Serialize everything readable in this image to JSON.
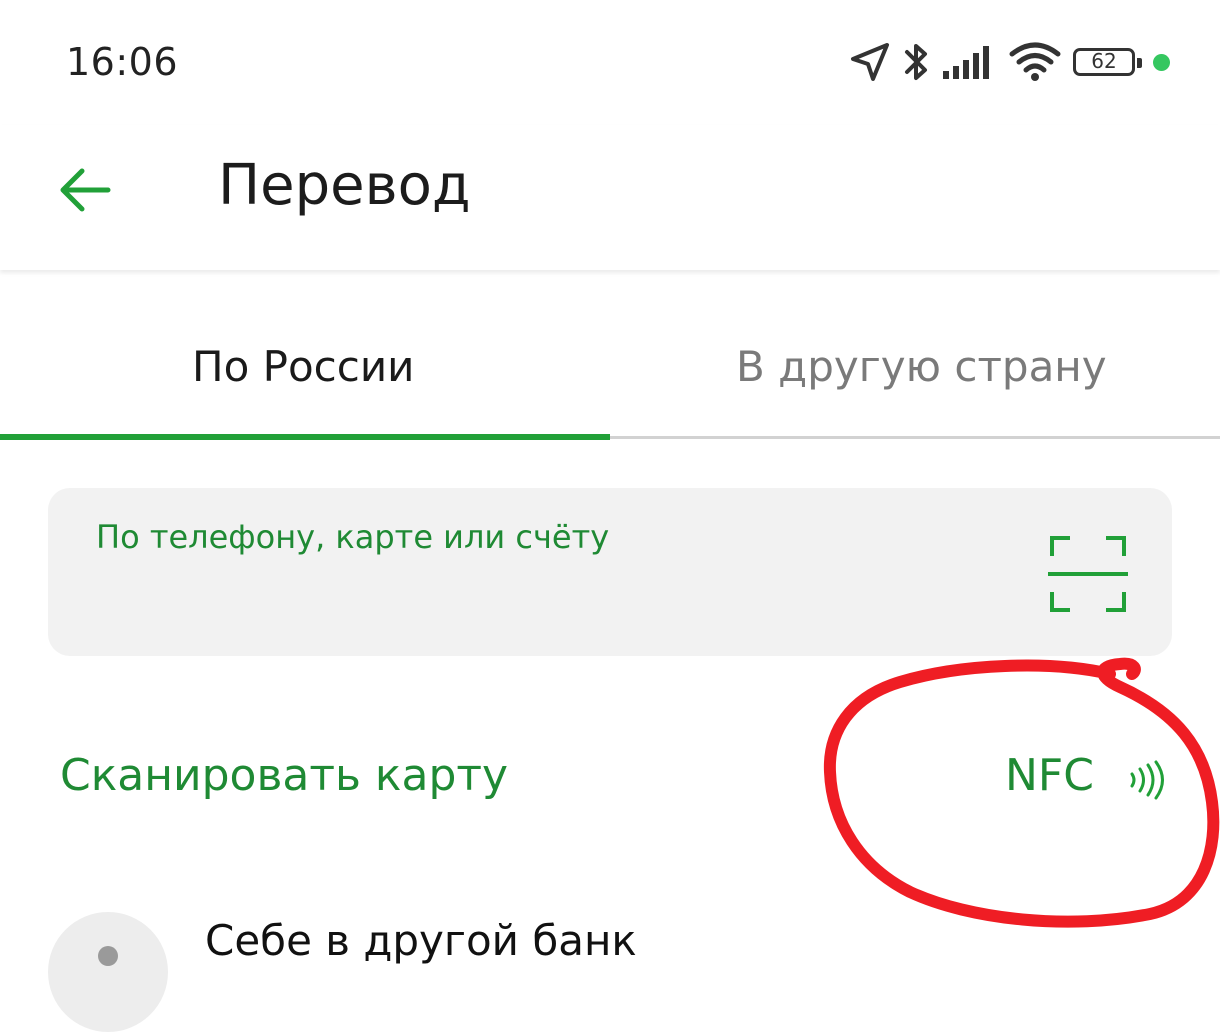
{
  "status_bar": {
    "time": "16:06",
    "battery": "62",
    "icons": [
      "location-arrow-icon",
      "bluetooth-icon",
      "signal-bars-icon",
      "wifi-icon",
      "battery-icon",
      "recording-dot-icon"
    ],
    "dot_color": "#35c760"
  },
  "header": {
    "title": "Перевод",
    "back_icon": "arrow-left-icon"
  },
  "tabs": [
    {
      "label": "По России",
      "active": true
    },
    {
      "label": "В другую страну",
      "active": false
    }
  ],
  "search": {
    "placeholder": "По телефону, карте или счёту",
    "scan_icon": "scan-frame-icon"
  },
  "actions": {
    "scan_card": "Сканировать карту",
    "nfc": "NFC",
    "nfc_icon": "contactless-waves-icon"
  },
  "list": [
    {
      "label": "Себе в другой банк",
      "icon": "avatar-circle-icon"
    }
  ],
  "colors": {
    "accent": "#21a038",
    "accent_text": "#1f8a34",
    "annotation": "#ef1d24",
    "tab_inactive": "#7a7a7a",
    "field_bg": "#f2f2f2"
  }
}
